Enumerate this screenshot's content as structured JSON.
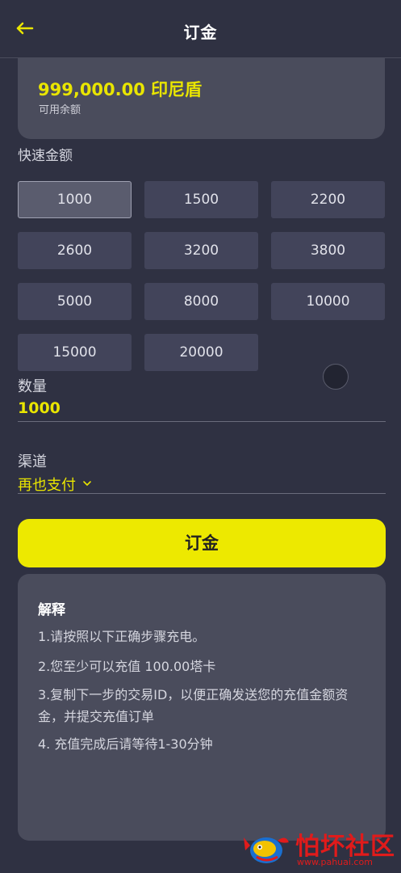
{
  "header": {
    "title": "订金",
    "back_icon": "arrow-left-icon"
  },
  "balance": {
    "amount": "999,000.00 印尼盾",
    "label": "可用余额"
  },
  "quick_amounts": {
    "label": "快速金额",
    "options": [
      "1000",
      "1500",
      "2200",
      "2600",
      "3200",
      "3800",
      "5000",
      "8000",
      "10000",
      "15000",
      "20000"
    ],
    "selected": "1000"
  },
  "quantity": {
    "label": "数量",
    "value": "1000"
  },
  "channel": {
    "label": "渠道",
    "value": "再也支付"
  },
  "submit": {
    "label": "订金"
  },
  "explanation": {
    "title": "解释",
    "lines": [
      "1.请按照以下正确步骤充电。",
      "2.您至少可以充值 100.00塔卡",
      "3.复制下一步的交易ID，以便正确发送您的充值金额资金，并提交充值订单",
      "4. 充值完成后请等待1-30分钟"
    ]
  },
  "watermark": {
    "text": "怕坏社区",
    "url": "www.pahuai.com"
  },
  "colors": {
    "background": "#2f3142",
    "card": "#4a4c5c",
    "accent": "#e9e500",
    "button": "#ede900"
  }
}
